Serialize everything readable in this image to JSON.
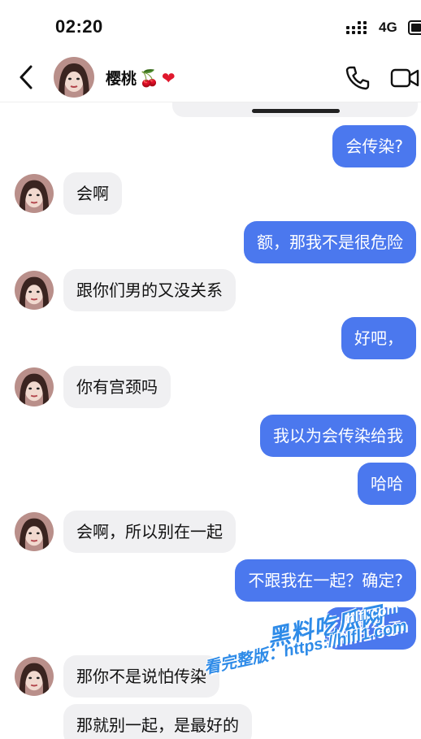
{
  "status_bar": {
    "time": "02:20",
    "network": "4G",
    "signal_icon": "signal-bars-icon",
    "battery_icon": "battery-icon"
  },
  "header": {
    "contact_name": "樱桃",
    "contact_emoji_1": "🍒",
    "contact_emoji_2": "❤",
    "icons": [
      "back-arrow-icon",
      "phone-icon",
      "video-icon"
    ]
  },
  "messages": [
    {
      "side": "out",
      "text": "会传染?"
    },
    {
      "side": "in",
      "text": "会啊"
    },
    {
      "side": "out",
      "text": "额，那我不是很危险"
    },
    {
      "side": "in",
      "text": "跟你们男的又没关系"
    },
    {
      "side": "out",
      "text": "好吧，"
    },
    {
      "side": "in",
      "text": "你有宫颈吗"
    },
    {
      "side": "out",
      "text": "我以为会传染给我"
    },
    {
      "side": "out",
      "text": "哈哈"
    },
    {
      "side": "in",
      "text": "会啊，所以别在一起"
    },
    {
      "side": "out",
      "text": "不跟我在一起？确定?"
    },
    {
      "side": "out",
      "text": "是要分手"
    },
    {
      "side": "in",
      "text": "那你不是说怕传染"
    },
    {
      "side": "in",
      "text": "那就别一起，是最好的"
    }
  ],
  "watermark": {
    "logo_text": "黑料吃瓜网",
    "logo_url": "hlfl.com",
    "line2": "看完整版：https://hlfl1.com"
  },
  "colors": {
    "outgoing_bubble": "#4b78ee",
    "incoming_bubble": "#f0f0f2",
    "watermark": "#2e8be8"
  }
}
